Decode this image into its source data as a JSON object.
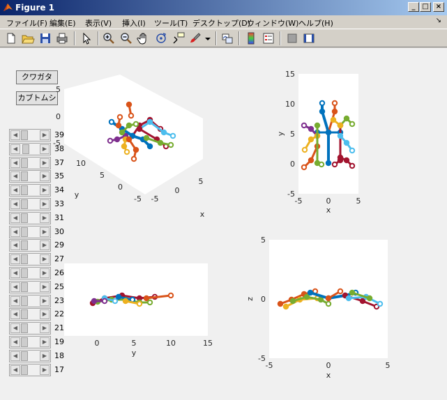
{
  "window": {
    "title": "Figure 1"
  },
  "menus": [
    "ファイル(F)",
    "編集(E)",
    "表示(V)",
    "挿入(I)",
    "ツール(T)",
    "デスクトップ(D)",
    "ウィンドウ(W)",
    "ヘルプ(H)"
  ],
  "toolbar_icons": [
    "new-file-icon",
    "open-folder-icon",
    "save-icon",
    "print-icon",
    "pointer-icon",
    "zoom-in-icon",
    "zoom-out-icon",
    "pan-hand-icon",
    "rotate-3d-icon",
    "data-cursor-icon",
    "brush-icon",
    "dropdown-arrow-icon",
    "link-plot-icon",
    "colorbar-icon",
    "legend-icon",
    "hide-plot-tools-icon",
    "show-plot-tools-icon"
  ],
  "buttons": {
    "kuwagata": "クワガタ",
    "kabutomushi": "カブトムシ"
  },
  "slider_labels": [
    "39",
    "38",
    "37",
    "35",
    "34",
    "33",
    "31",
    "30",
    "29",
    "27",
    "26",
    "25",
    "23",
    "22",
    "21",
    "19",
    "18",
    "17"
  ],
  "axes": {
    "a3d": {
      "z_ticks": [
        "5",
        "0",
        "-5"
      ],
      "y_ticks": [
        "10",
        "5",
        "0",
        "-5"
      ],
      "x_ticks": [
        "-5",
        "0",
        "5"
      ],
      "xlabel": "x",
      "ylabel": "y"
    },
    "top_view": {
      "y_ticks": [
        "15",
        "10",
        "5",
        "0",
        "-5"
      ],
      "x_ticks": [
        "-5",
        "0",
        "5"
      ],
      "xlabel": "x",
      "ylabel": "y"
    },
    "side_view": {
      "x_ticks": [
        "0",
        "5",
        "10",
        "15"
      ],
      "xlabel": "y"
    },
    "front_view": {
      "y_ticks": [
        "5",
        "0",
        "-5"
      ],
      "x_ticks": [
        "-5",
        "0",
        "5"
      ],
      "xlabel": "x",
      "ylabel": "z"
    }
  },
  "colors": {
    "blue": "#0072bd",
    "orange": "#d95319",
    "yellow": "#edb120",
    "purple": "#7e2f8e",
    "green": "#77ac30",
    "cyan": "#4dbeee",
    "red": "#a2142f"
  }
}
